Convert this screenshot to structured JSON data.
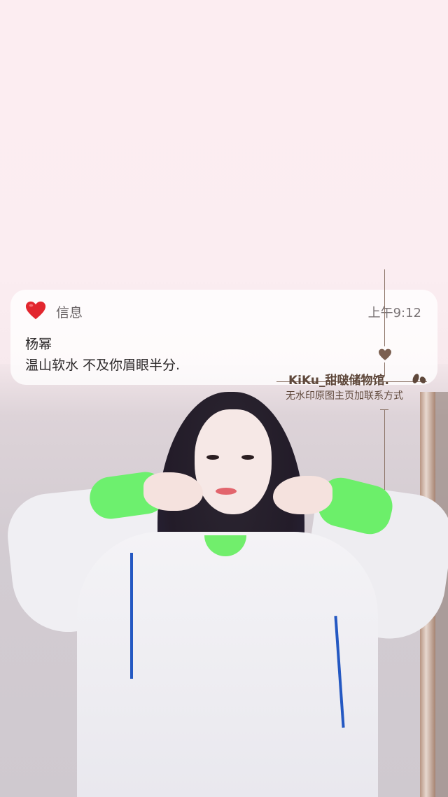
{
  "notification": {
    "app_icon": "heart-icon",
    "app_name": "信息",
    "time": "上午9:12",
    "sender": "杨幂",
    "message": "温山软水 不及你眉眼半分."
  },
  "watermark": {
    "title": "KiKu_甜啵储物馆.",
    "subtitle": "无水印原图主页加联系方式",
    "heart_icon": "heart-icon",
    "leaf_icon": "leaf-icon"
  },
  "colors": {
    "background": "#fbeef2",
    "heart": "#e2262e",
    "watermark_text": "#5e473a",
    "accent_green": "#6df06e",
    "drawstring_blue": "#2458c2"
  }
}
